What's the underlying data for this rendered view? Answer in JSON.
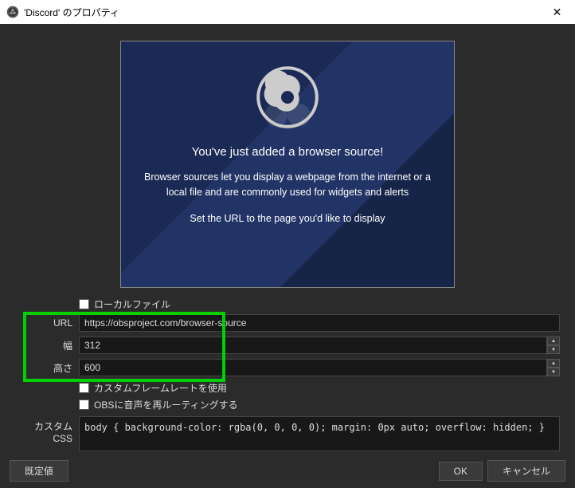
{
  "window": {
    "title": "'Discord' のプロパティ"
  },
  "preview": {
    "heading": "You've just added a browser source!",
    "desc": "Browser sources let you display a webpage from the internet or a local file and are commonly used for widgets and alerts",
    "hint": "Set the URL to the page you'd like to display"
  },
  "form": {
    "local_file_label": "ローカルファイル",
    "url_label": "URL",
    "url_value": "https://obsproject.com/browser-source",
    "width_label": "幅",
    "width_value": "312",
    "height_label": "高さ",
    "height_value": "600",
    "custom_fps_label": "カスタムフレームレートを使用",
    "reroute_audio_label": "OBSに音声を再ルーティングする",
    "custom_css_label": "カスタム CSS",
    "custom_css_value": "body { background-color: rgba(0, 0, 0, 0); margin: 0px auto; overflow: hidden; }"
  },
  "buttons": {
    "defaults": "既定値",
    "ok": "OK",
    "cancel": "キャンセル"
  }
}
